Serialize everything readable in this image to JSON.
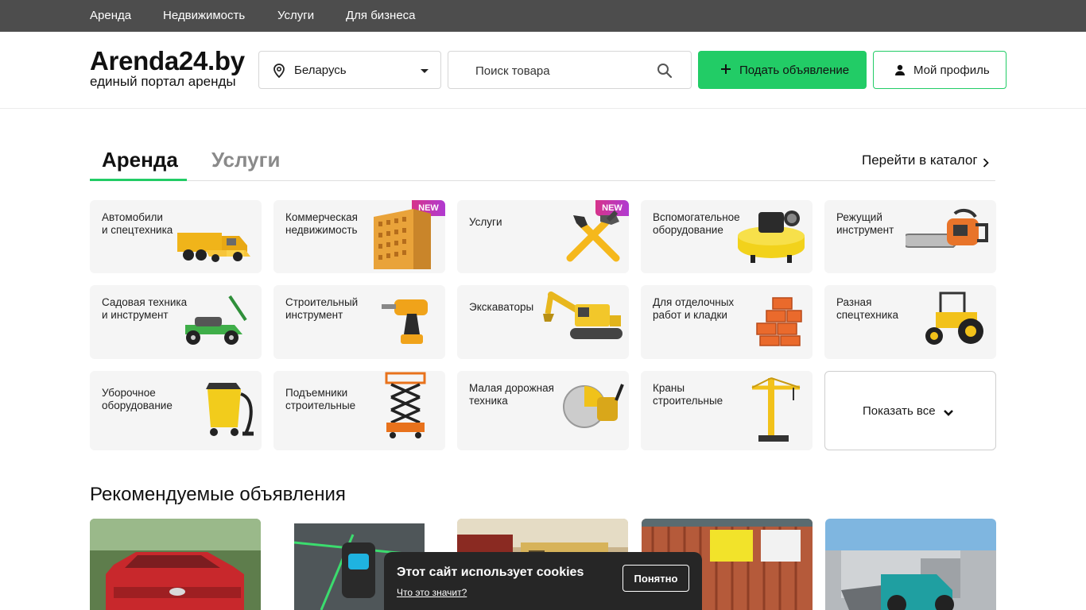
{
  "topnav": [
    "Аренда",
    "Недвижимость",
    "Услуги",
    "Для бизнеса"
  ],
  "logo": {
    "title": "Arenda24.by",
    "subtitle": "единый портал аренды"
  },
  "region": {
    "label": "Беларусь",
    "icon": "map-pin-icon"
  },
  "search": {
    "placeholder": "Поиск товара",
    "icon": "search-icon"
  },
  "buttons": {
    "post": "Подать объявление",
    "post_icon": "plus-icon",
    "profile": "Мой профиль",
    "profile_icon": "user-icon"
  },
  "tabs": {
    "active": "Аренда",
    "inactive": "Услуги"
  },
  "catalog_link": "Перейти в каталог",
  "badge_new": "NEW",
  "categories": [
    {
      "name": "Автомобили\nи спецтехника",
      "icon": "dump-truck-icon"
    },
    {
      "name": "Коммерческая\nнедвижимость",
      "icon": "building-icon",
      "new": true
    },
    {
      "name": "Услуги",
      "icon": "hammer-wrench-icon",
      "new": true
    },
    {
      "name": "Вспомогательное\nоборудование",
      "icon": "compressor-icon"
    },
    {
      "name": "Режущий\nинструмент",
      "icon": "chainsaw-icon"
    },
    {
      "name": "Садовая техника\nи инструмент",
      "icon": "lawn-mower-icon"
    },
    {
      "name": "Строительный\nинструмент",
      "icon": "drill-icon"
    },
    {
      "name": "Экскаваторы",
      "icon": "excavator-icon"
    },
    {
      "name": "Для отделочных\nработ и кладки",
      "icon": "bricks-icon"
    },
    {
      "name": "Разная\nспецтехника",
      "icon": "tractor-icon"
    },
    {
      "name": "Уборочное\nоборудование",
      "icon": "vacuum-icon"
    },
    {
      "name": "Подъемники\nстроительные",
      "icon": "scissor-lift-icon"
    },
    {
      "name": "Малая дорожная\nтехника",
      "icon": "road-cutter-icon"
    },
    {
      "name": "Краны\nстроительные",
      "icon": "crane-icon"
    }
  ],
  "show_all": "Показать все",
  "recommended_title": "Рекомендуемые объявления",
  "cookie": {
    "title": "Этот сайт использует cookies",
    "link": "Что это значит?",
    "button": "Понятно"
  },
  "colors": {
    "accent": "#22cc66",
    "topbar": "#4d4d4d",
    "card": "#f5f5f5"
  }
}
